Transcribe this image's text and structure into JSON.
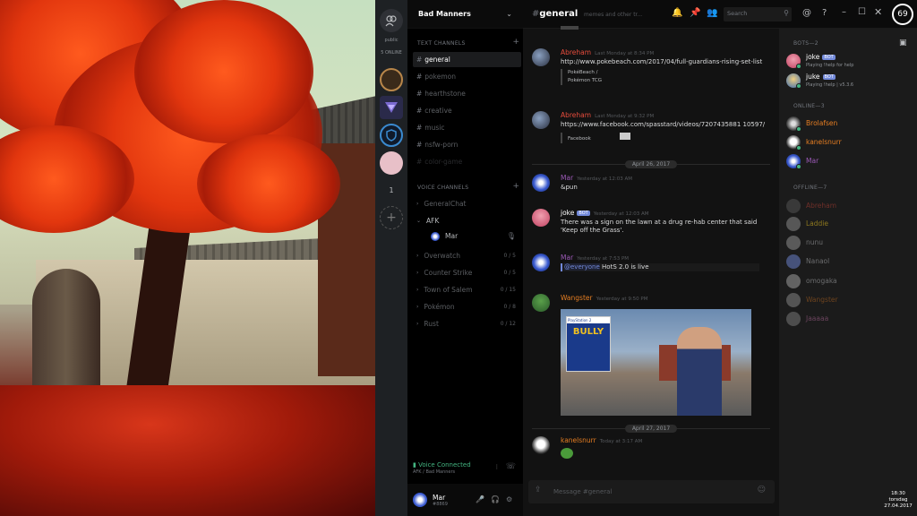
{
  "servers": {
    "direct_label": "public",
    "online_label": "5 ONLINE",
    "more_count": "1"
  },
  "guild": {
    "name": "Bad Manners"
  },
  "text_channels": {
    "header": "TEXT CHANNELS",
    "items": [
      "general",
      "pokemon",
      "hearthstone",
      "creative",
      "music",
      "nsfw-porn",
      "color-game"
    ]
  },
  "voice_channels": {
    "header": "VOICE CHANNELS",
    "items": [
      {
        "name": "GeneralChat",
        "count": ""
      },
      {
        "name": "AFK",
        "count": ""
      },
      {
        "name": "Overwatch",
        "count": "0 / 5"
      },
      {
        "name": "Counter Strike",
        "count": "0 / 5"
      },
      {
        "name": "Town of Salem",
        "count": "0 / 15"
      },
      {
        "name": "Pokémon",
        "count": "0 / 8"
      },
      {
        "name": "Rust",
        "count": "0 / 12"
      }
    ],
    "afk_member": "Mar"
  },
  "voice_status": {
    "title": "Voice Connected",
    "detail": "AFK / Bad Manners"
  },
  "user": {
    "name": "Mar",
    "tag": "#8869"
  },
  "chat": {
    "channel": "general",
    "topic": "memes and other tr...",
    "search_placeholder": "Search",
    "input_placeholder": "Message #general",
    "messages": [
      {
        "author": "Abreham",
        "time": "Last Monday at 8:34 PM",
        "text": "http://www.pokebeach.com/2017/04/full-guardians-rising-set-list",
        "embed1": "PokéBeach /",
        "embed2": "Pokémon TCG"
      },
      {
        "author": "Abreham",
        "time": "Last Monday at 9:32 PM",
        "text": "https://www.facebook.com/spasstard/videos/7207435881 10597/",
        "embed1": "Facebook"
      },
      {
        "author": "Mar",
        "time": "Yesterday at 12:03 AM",
        "text": "&pun"
      },
      {
        "author": "joke",
        "bot": "BOT",
        "time": "Yesterday at 12:03 AM",
        "text": "There was a sign on the lawn at a drug re-hab center that said 'Keep off the Grass'."
      },
      {
        "author": "Mar",
        "time": "Yesterday at 7:53 PM",
        "mention": "@everyone",
        "text": " HotS 2.0 is live"
      },
      {
        "author": "Wangster",
        "time": "Yesterday at 9:50 PM",
        "image_title": "BULLY"
      },
      {
        "author": "kanelsnurr",
        "time": "Today at 3:17 AM"
      }
    ],
    "date1": "April 26, 2017",
    "date2": "April 27, 2017"
  },
  "members": {
    "bots_header": "BOTS—2",
    "bots": [
      {
        "name": "joke",
        "tag": "BOT",
        "game": "Playing !help for help"
      },
      {
        "name": "juke",
        "tag": "BOT",
        "game": "Playing !help | v5.3.6"
      }
    ],
    "online_header": "ONLINE—3",
    "online": [
      "Brolafsen",
      "kanelsnurr",
      "Mar"
    ],
    "offline_header": "OFFLINE—7",
    "offline": [
      "Abreham",
      "Laddie",
      "nunu",
      "Nanaol",
      "omogaka",
      "Wangster",
      "Jaaaaa"
    ]
  },
  "clock": {
    "time": "18:30",
    "day": "torsdag",
    "date": "27.04.2017"
  },
  "colors": {
    "online": "#43b581",
    "orange_role": "#e67e22",
    "purple_role": "#9b59b6",
    "bot_tag": "#7289da"
  }
}
